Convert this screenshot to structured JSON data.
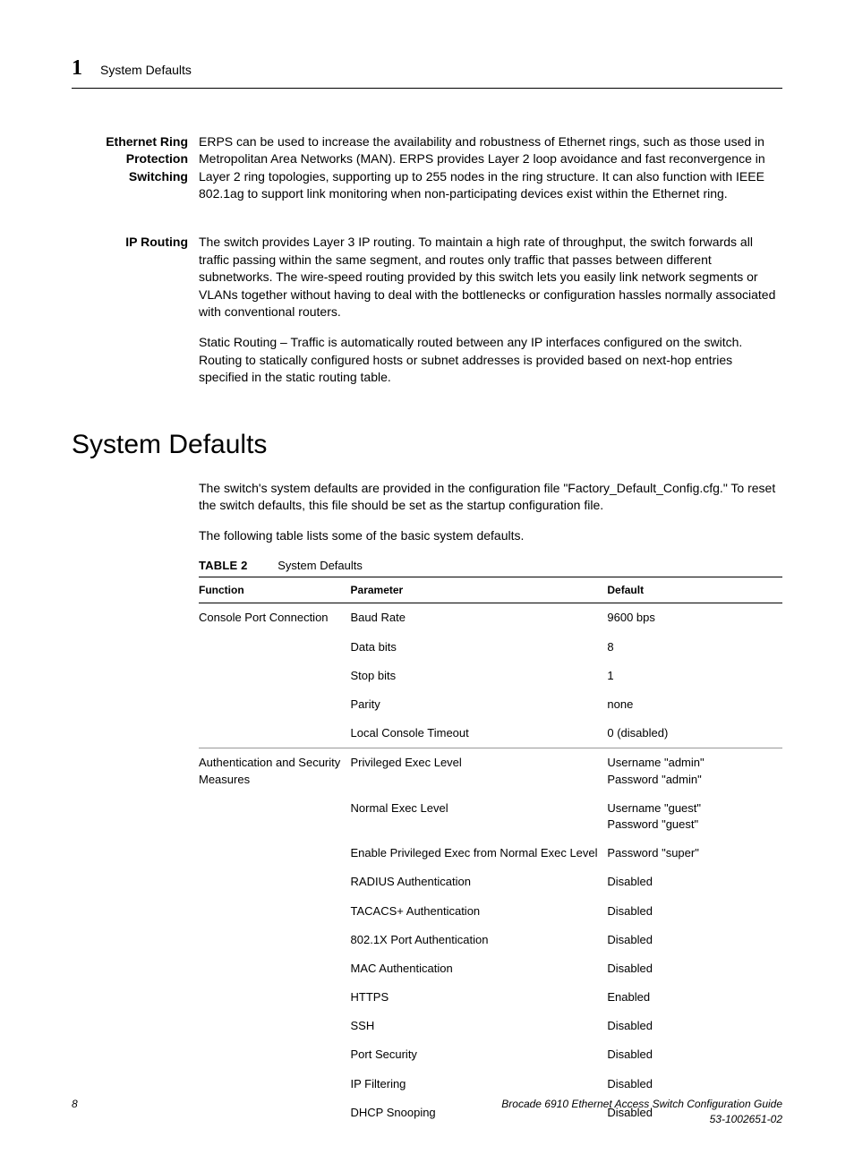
{
  "header": {
    "chapter_number": "1",
    "title": "System Defaults"
  },
  "features": [
    {
      "label": "Ethernet Ring Protection Switching",
      "paragraphs": [
        "ERPS can be used to increase the availability and robustness of Ethernet rings, such as those used in Metropolitan Area Networks (MAN). ERPS provides Layer 2 loop avoidance and fast reconvergence in Layer 2 ring topologies, supporting up to 255 nodes in the ring structure. It can also function with IEEE 802.1ag to support link monitoring when non-participating devices exist within the Ethernet ring."
      ]
    },
    {
      "label": "IP Routing",
      "paragraphs": [
        "The switch provides Layer 3 IP routing. To maintain a high rate of throughput, the switch forwards all traffic passing within the same segment, and routes only traffic that passes between different subnetworks. The wire-speed routing provided by this switch lets you easily link network segments or VLANs together without having to deal with the bottlenecks or configuration hassles normally associated with conventional routers.",
        "Static Routing – Traffic is automatically routed between any IP interfaces configured on the switch. Routing to statically configured hosts or subnet addresses is provided based on next-hop entries specified in the static routing table."
      ]
    }
  ],
  "section": {
    "heading": "System Defaults",
    "paragraphs": [
      "The switch's system defaults are provided in the configuration file \"Factory_Default_Config.cfg.\" To reset the switch defaults, this file should be set as the startup configuration file.",
      "The following table lists some of the basic system defaults."
    ]
  },
  "table": {
    "caption_label": "TABLE 2",
    "caption_text": "System Defaults",
    "headers": {
      "func": "Function",
      "param": "Parameter",
      "def": "Default"
    },
    "groups": [
      {
        "function": "Console Port Connection",
        "rows": [
          {
            "param": "Baud Rate",
            "def": "9600 bps"
          },
          {
            "param": "Data bits",
            "def": "8"
          },
          {
            "param": "Stop bits",
            "def": "1"
          },
          {
            "param": "Parity",
            "def": "none"
          },
          {
            "param": "Local Console Timeout",
            "def": "0 (disabled)"
          }
        ]
      },
      {
        "function": "Authentication and Security Measures",
        "rows": [
          {
            "param": "Privileged Exec Level",
            "def": "Username \"admin\"\nPassword \"admin\""
          },
          {
            "param": "Normal Exec Level",
            "def": "Username \"guest\"\nPassword \"guest\""
          },
          {
            "param": "Enable Privileged Exec from Normal Exec Level",
            "def": "Password \"super\""
          },
          {
            "param": "RADIUS Authentication",
            "def": "Disabled"
          },
          {
            "param": "TACACS+ Authentication",
            "def": "Disabled"
          },
          {
            "param": "802.1X Port Authentication",
            "def": "Disabled"
          },
          {
            "param": "MAC Authentication",
            "def": "Disabled"
          },
          {
            "param": "HTTPS",
            "def": "Enabled"
          },
          {
            "param": "SSH",
            "def": "Disabled"
          },
          {
            "param": "Port Security",
            "def": "Disabled"
          },
          {
            "param": "IP Filtering",
            "def": "Disabled"
          },
          {
            "param": "DHCP Snooping",
            "def": "Disabled"
          }
        ]
      }
    ]
  },
  "footer": {
    "page_number": "8",
    "doc_title": "Brocade 6910 Ethernet Access Switch Configuration Guide",
    "doc_number": "53-1002651-02"
  }
}
